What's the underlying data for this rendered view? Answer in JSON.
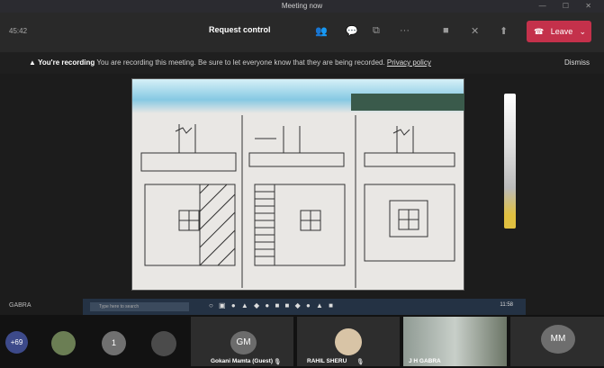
{
  "window": {
    "title": "Meeting now",
    "controls": "— ☐ ✕"
  },
  "toolbar": {
    "timer": "45:42",
    "request_control": "Request control",
    "leave": "Leave",
    "tools": [
      {
        "name": "participants-icon",
        "glyph": "👥"
      },
      {
        "name": "chat-icon",
        "glyph": "💬"
      },
      {
        "name": "rooms-icon",
        "glyph": "⧉"
      },
      {
        "name": "more-icon",
        "glyph": "···"
      },
      {
        "name": "camera-icon",
        "glyph": "■"
      },
      {
        "name": "mic-off-icon",
        "glyph": "✕"
      },
      {
        "name": "share-icon",
        "glyph": "⬆"
      }
    ]
  },
  "recording": {
    "title": "You're recording",
    "message": "You are recording this meeting. Be sure to let everyone know that they are being recorded.",
    "link": "Privacy policy",
    "dismiss": "Dismiss"
  },
  "shared": {
    "presenter_label": "GABRA",
    "search_placeholder": "Type here to search",
    "clock": "11:58"
  },
  "participants": [
    {
      "initials": "+69"
    },
    {
      "initials": ""
    },
    {
      "initials": "1"
    },
    {
      "initials": ""
    },
    {
      "initials": "GM",
      "name": "Gokani Mamta (Guest)"
    },
    {
      "initials": "",
      "name": "RAHIL SHERU"
    },
    {
      "initials": "",
      "name": "J H GABRA"
    },
    {
      "initials": "MM"
    }
  ]
}
